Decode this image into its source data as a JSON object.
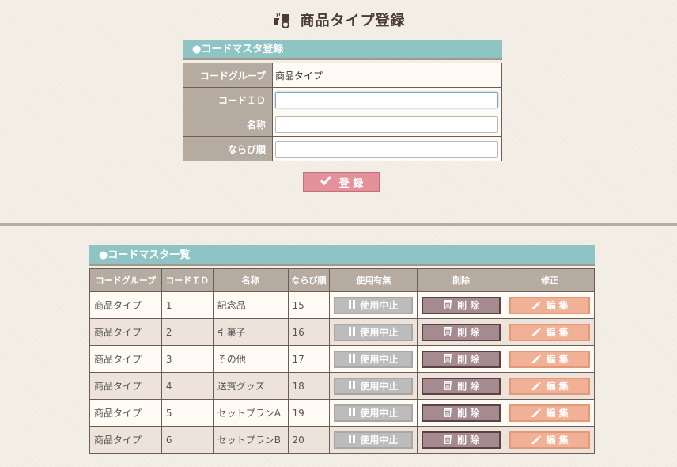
{
  "page": {
    "title": "商品タイプ登録",
    "icon": "coffee-cup-icon"
  },
  "register": {
    "heading": "●コードマスタ登録",
    "fields": [
      {
        "label": "コードグループ",
        "value": "商品タイプ",
        "type": "text"
      },
      {
        "label": "コードＩＤ",
        "value": "",
        "type": "input",
        "focused": true
      },
      {
        "label": "名称",
        "value": "",
        "type": "input"
      },
      {
        "label": "ならび順",
        "value": "",
        "type": "input"
      }
    ],
    "submit_label": "登 録",
    "submit_icon": "check-icon"
  },
  "list": {
    "heading": "●コードマスタ一覧",
    "columns": [
      "コードグループ",
      "コードＩＤ",
      "名称",
      "ならび順",
      "使用有無",
      "削除",
      "修正"
    ],
    "buttons": {
      "stop_label": "使用中止",
      "stop_icon": "pause-icon",
      "delete_label": "削 除",
      "delete_icon": "trash-icon",
      "edit_label": "編 集",
      "edit_icon": "pencil-icon"
    },
    "rows": [
      {
        "group": "商品タイプ",
        "id": "1",
        "name": "記念品",
        "order": "15"
      },
      {
        "group": "商品タイプ",
        "id": "2",
        "name": "引菓子",
        "order": "16"
      },
      {
        "group": "商品タイプ",
        "id": "3",
        "name": "その他",
        "order": "17"
      },
      {
        "group": "商品タイプ",
        "id": "4",
        "name": "送賓グッズ",
        "order": "18"
      },
      {
        "group": "商品タイプ",
        "id": "5",
        "name": "セットプランA",
        "order": "19"
      },
      {
        "group": "商品タイプ",
        "id": "6",
        "name": "セットプランB",
        "order": "20"
      }
    ]
  },
  "colors": {
    "header_teal": "#8ec4c4",
    "label_bg": "#b5aba1",
    "register_button": "#e3919b",
    "stop_button": "#bcbcbc",
    "delete_button": "#a58b8f",
    "edit_button": "#f1b196"
  }
}
